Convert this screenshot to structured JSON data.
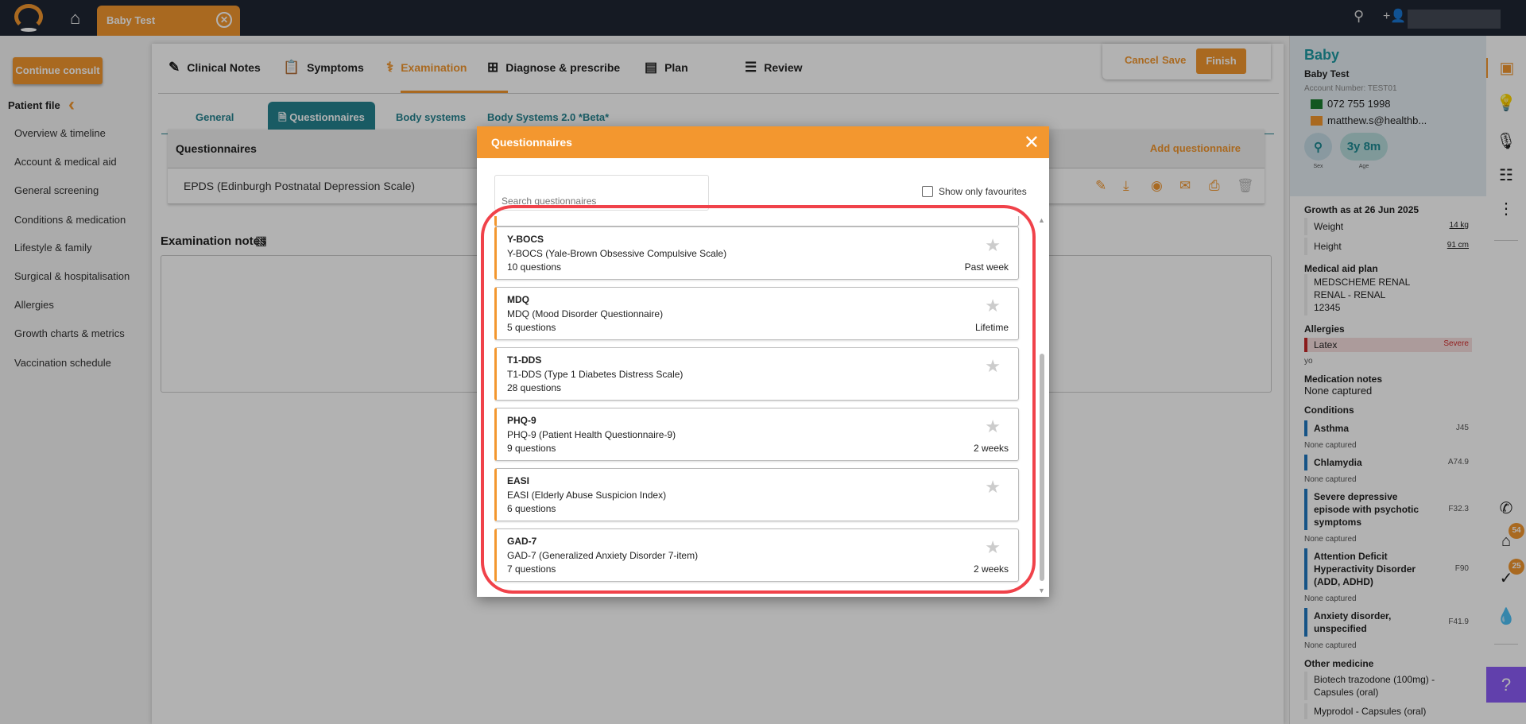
{
  "topbar": {
    "patient_tab": "Baby Test"
  },
  "sidebar": {
    "continue": "Continue consult",
    "patient_file": "Patient file",
    "items": [
      "Overview & timeline",
      "Account & medical aid",
      "General screening",
      "Conditions & medication",
      "Lifestyle & family",
      "Surgical & hospitalisation",
      "Allergies",
      "Growth charts & metrics",
      "Vaccination schedule"
    ]
  },
  "tabs": [
    "Clinical Notes",
    "Symptoms",
    "Examination",
    "Diagnose & prescribe",
    "Plan",
    "Review"
  ],
  "subtabs": [
    "General",
    "Questionnaires",
    "Body systems",
    "Body Systems 2.0 *Beta*"
  ],
  "actions": {
    "cancel": "Cancel",
    "save": "Save",
    "finish": "Finish"
  },
  "qtable": {
    "title": "Questionnaires",
    "add": "Add questionnaire",
    "row": "EPDS (Edinburgh Postnatal Depression Scale)"
  },
  "notes": {
    "title": "Examination notes"
  },
  "patient": {
    "short": "Baby",
    "full": "Baby Test",
    "account": "Account Number: TEST01",
    "phone": "072 755 1998",
    "email": "matthew.s@healthb...",
    "age": "3y 8m",
    "sex_label": "Sex",
    "age_label": "Age",
    "growth_title": "Growth as at 26 Jun 2025",
    "weight_label": "Weight",
    "weight": "14 kg",
    "height_label": "Height",
    "height": "91 cm",
    "medaid_title": "Medical aid plan",
    "medaid": [
      "MEDSCHEME RENAL",
      "RENAL - RENAL",
      "12345"
    ],
    "allergies_title": "Allergies",
    "allergy": "Latex",
    "allergy_sev": "Severe",
    "allergy_note": "yo",
    "mednotes_title": "Medication notes",
    "mednotes": "None captured",
    "conditions_title": "Conditions",
    "conditions": [
      {
        "name": "Asthma",
        "code": "J45",
        "note": "None captured"
      },
      {
        "name": "Chlamydia",
        "code": "A74.9",
        "note": "None captured"
      },
      {
        "name": "Severe depressive episode with psychotic symptoms",
        "code": "F32.3",
        "note": "None captured"
      },
      {
        "name": "Attention Deficit Hyperactivity Disorder (ADD, ADHD)",
        "code": "F90",
        "note": "None captured"
      },
      {
        "name": "Anxiety disorder, unspecified",
        "code": "F41.9",
        "note": "None captured"
      }
    ],
    "othermed_title": "Other medicine",
    "othermed": [
      "Biotech trazodone (100mg) - Capsules (oral)",
      "Myprodol - Capsules (oral)"
    ]
  },
  "rail": {
    "badge_inbox": "54",
    "badge_tasks": "25"
  },
  "modal": {
    "title": "Questionnaires",
    "search_placeholder": "Search questionnaires",
    "fav_label": "Show only favourites",
    "items": [
      {
        "code": "Y-BOCS",
        "name": "Y-BOCS (Yale-Brown Obsessive Compulsive Scale)",
        "count": "10 questions",
        "period": "Past week"
      },
      {
        "code": "MDQ",
        "name": "MDQ (Mood Disorder Questionnaire)",
        "count": "5 questions",
        "period": "Lifetime"
      },
      {
        "code": "T1-DDS",
        "name": "T1-DDS (Type 1 Diabetes Distress Scale)",
        "count": "28 questions",
        "period": ""
      },
      {
        "code": "PHQ-9",
        "name": "PHQ-9 (Patient Health Questionnaire-9)",
        "count": "9 questions",
        "period": "2 weeks"
      },
      {
        "code": "EASI",
        "name": "EASI (Elderly Abuse Suspicion Index)",
        "count": "6 questions",
        "period": ""
      },
      {
        "code": "GAD-7",
        "name": "GAD-7 (Generalized Anxiety Disorder 7-item)",
        "count": "7 questions",
        "period": "2 weeks"
      }
    ]
  },
  "colors": {
    "accent": "#f3972f",
    "teal": "#258390",
    "annotation": "#f0424a",
    "help": "#8b5cf6"
  }
}
